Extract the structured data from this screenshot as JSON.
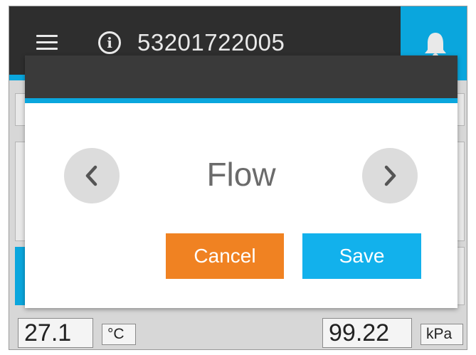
{
  "header": {
    "device_id": "53201722005",
    "icons": {
      "menu": "menu-icon",
      "info": "info-icon",
      "alarm": "bell-icon"
    }
  },
  "dialog": {
    "selector_value": "Flow",
    "cancel_label": "Cancel",
    "save_label": "Save",
    "icons": {
      "prev": "chevron-left-icon",
      "next": "chevron-right-icon"
    }
  },
  "readings": {
    "temperature": {
      "value": "27.1",
      "unit": "°C"
    },
    "pressure": {
      "value": "99.22",
      "unit": "kPa"
    }
  },
  "colors": {
    "accent": "#0aa6dd",
    "header_bg": "#2e2e2e",
    "cancel": "#f08222",
    "save": "#12b1ec"
  }
}
